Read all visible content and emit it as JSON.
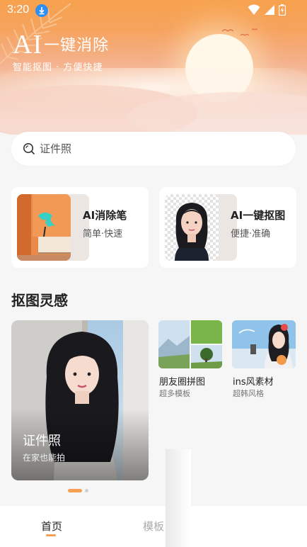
{
  "status": {
    "time": "3:20"
  },
  "brand": {
    "title_ai": "AI",
    "title_cn": "一键消除",
    "subtitle": "智能抠图 · 方便快捷"
  },
  "search": {
    "placeholder": "证件照"
  },
  "features": [
    {
      "title": "AI消除笔",
      "subtitle": "简单·快速"
    },
    {
      "title": "AI一键抠图",
      "subtitle": "便捷·准确"
    }
  ],
  "section": {
    "title": "抠图灵感"
  },
  "inspiration": {
    "big": {
      "title": "证件照",
      "subtitle": "在家也能拍"
    },
    "small": [
      {
        "title": "朋友圈拼图",
        "subtitle": "超多模板"
      },
      {
        "title": "ins风素材",
        "subtitle": "超韩风格"
      }
    ]
  },
  "carousel": {
    "active": 0,
    "count": 2
  },
  "bottom_nav": [
    {
      "label": "首页",
      "active": true
    },
    {
      "label": "模板",
      "active": false
    }
  ],
  "colors": {
    "accent": "#f5a052",
    "banner_top": "#f7a24d",
    "background": "#f6f6f6"
  },
  "icons": [
    "download-icon",
    "wifi-icon",
    "signal-icon",
    "battery-icon",
    "search-icon"
  ]
}
